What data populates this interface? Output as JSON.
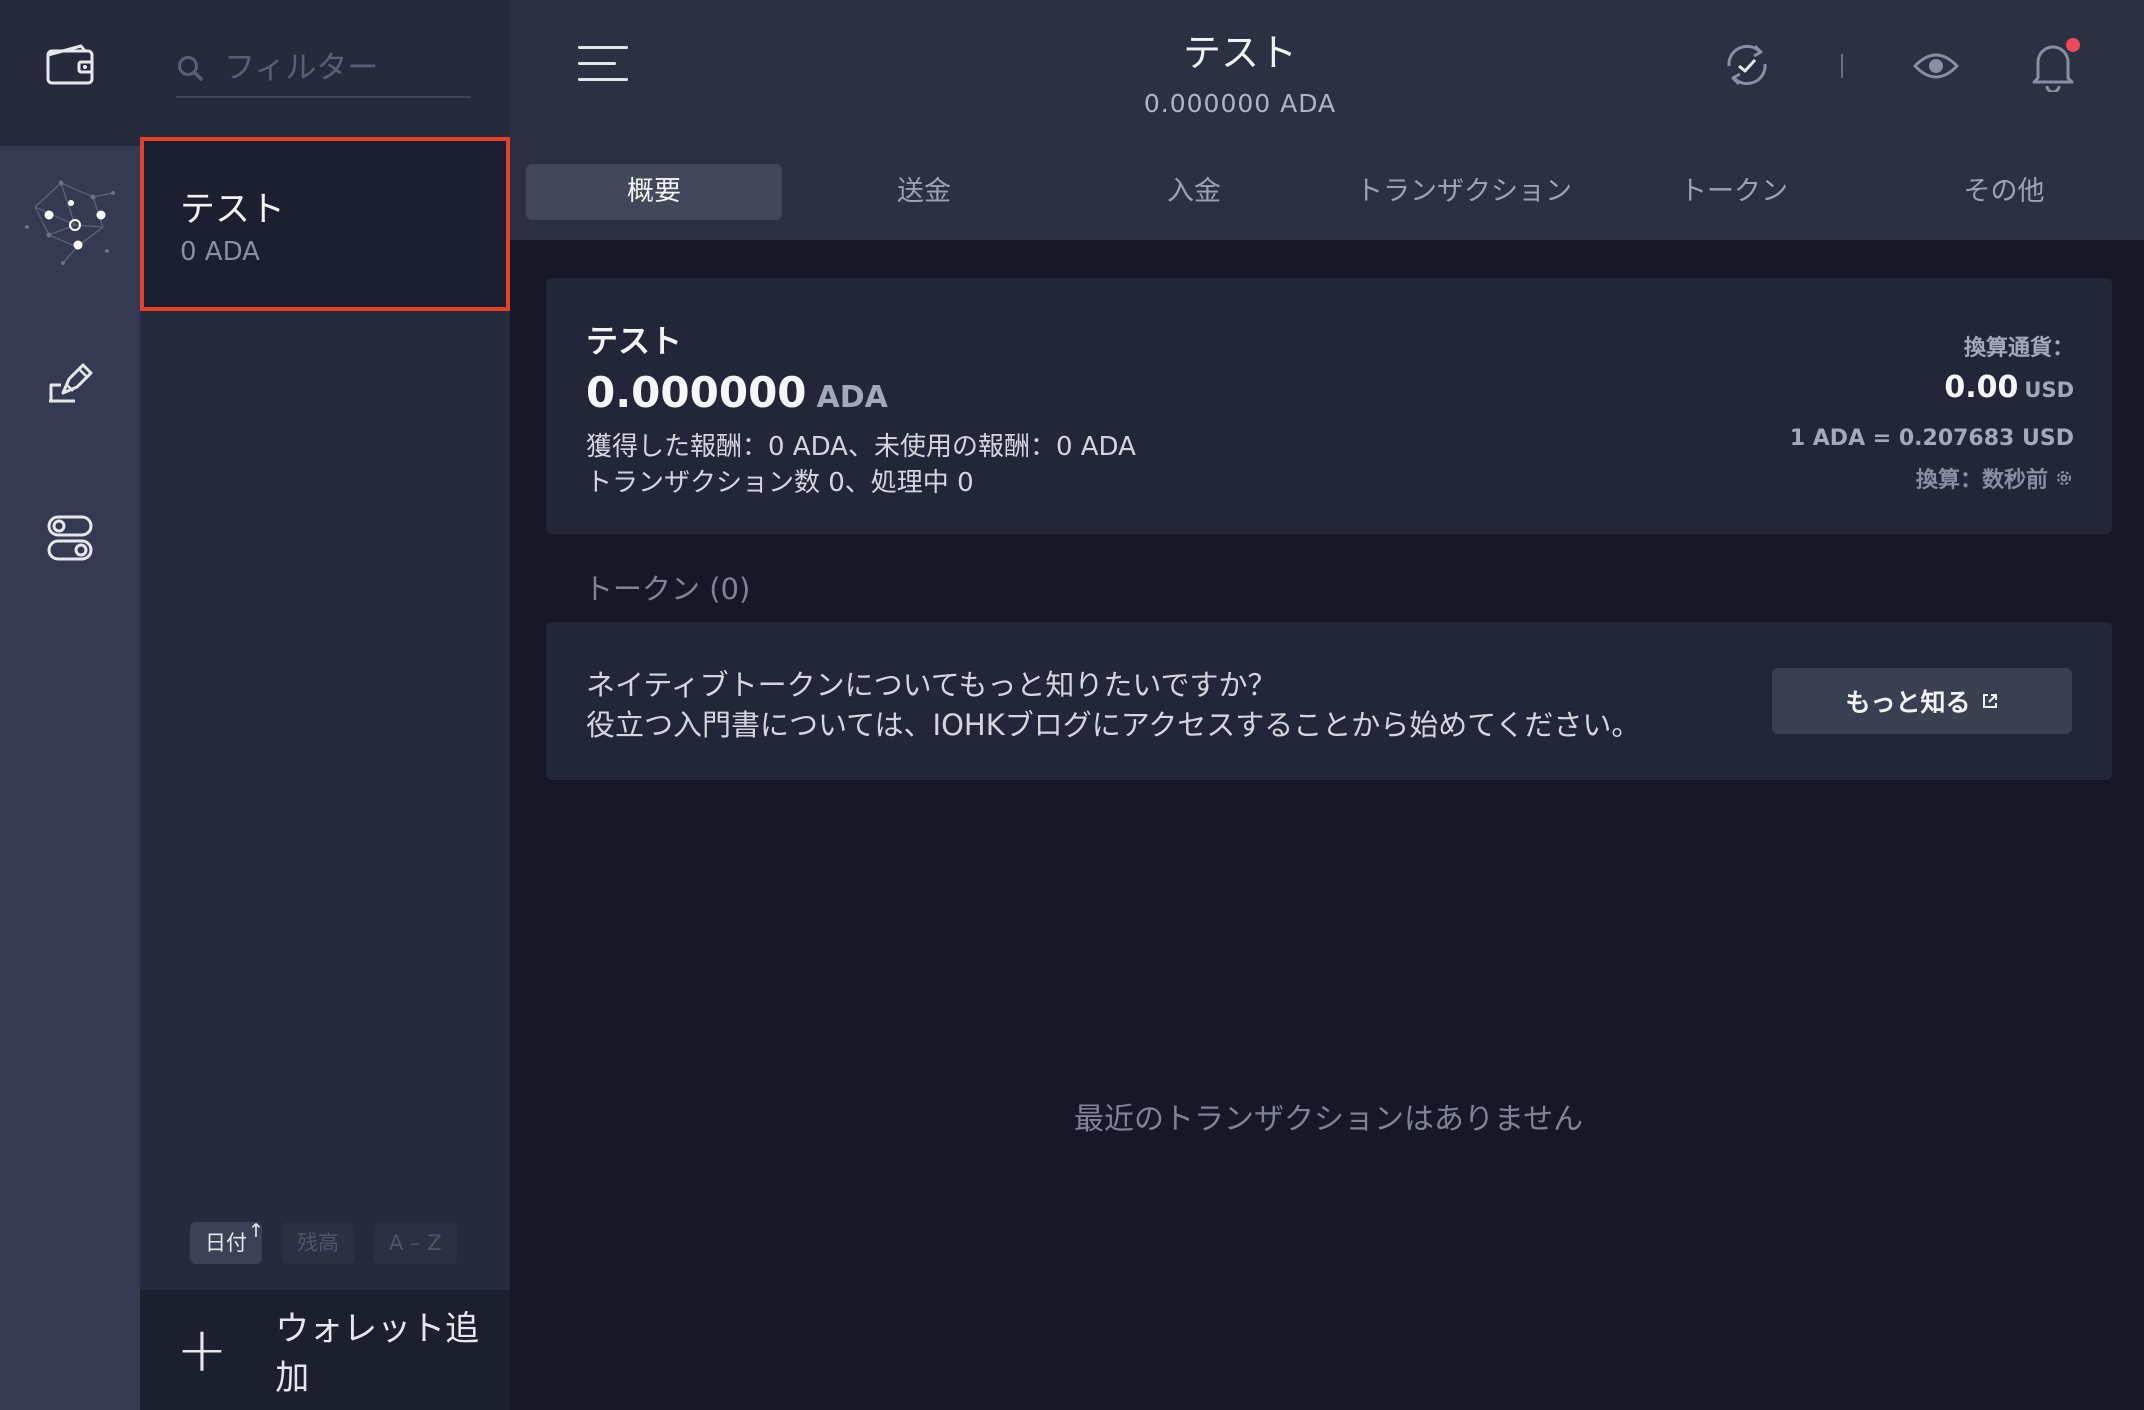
{
  "sidebar": {
    "icons": [
      "wallet-icon",
      "staking-network-icon",
      "voting-icon",
      "settings-toggle-icon"
    ]
  },
  "wallet_list": {
    "filter_placeholder": "フィルター",
    "wallets": [
      {
        "name": "テスト",
        "balance": "0 ADA"
      }
    ],
    "sort": {
      "date": "日付",
      "date_arrow": "↑",
      "balance": "残高",
      "az": "A – Z"
    },
    "add_wallet": "ウォレット追加"
  },
  "header": {
    "title": "テスト",
    "balance": "0.000000 ADA",
    "notification_color": "#e84a5a"
  },
  "tabs": [
    "概要",
    "送金",
    "入金",
    "トランザクション",
    "トークン",
    "その他"
  ],
  "summary": {
    "wallet_name": "テスト",
    "balance_value": "0.000000",
    "balance_unit": "ADA",
    "rewards": "獲得した報酬：0 ADA、未使用の報酬：0 ADA",
    "transactions": "トランザクション数 0、処理中 0",
    "currency_label": "換算通貨：",
    "converted_value": "0.00",
    "converted_unit": "USD",
    "rate": "1 ADA = 0.207683 USD",
    "updated": "換算：数秒前"
  },
  "tokens": {
    "header": "トークン (0)",
    "line1": "ネイティブトークンについてもっと知りたいですか？",
    "line2": "役立つ入門書については、IOHKブログにアクセスすることから始めてください。",
    "learn_more": "もっと知る"
  },
  "empty_state": "最近のトランザクションはありません",
  "colors": {
    "accent_border": "#e2412c",
    "background": "#161827"
  }
}
